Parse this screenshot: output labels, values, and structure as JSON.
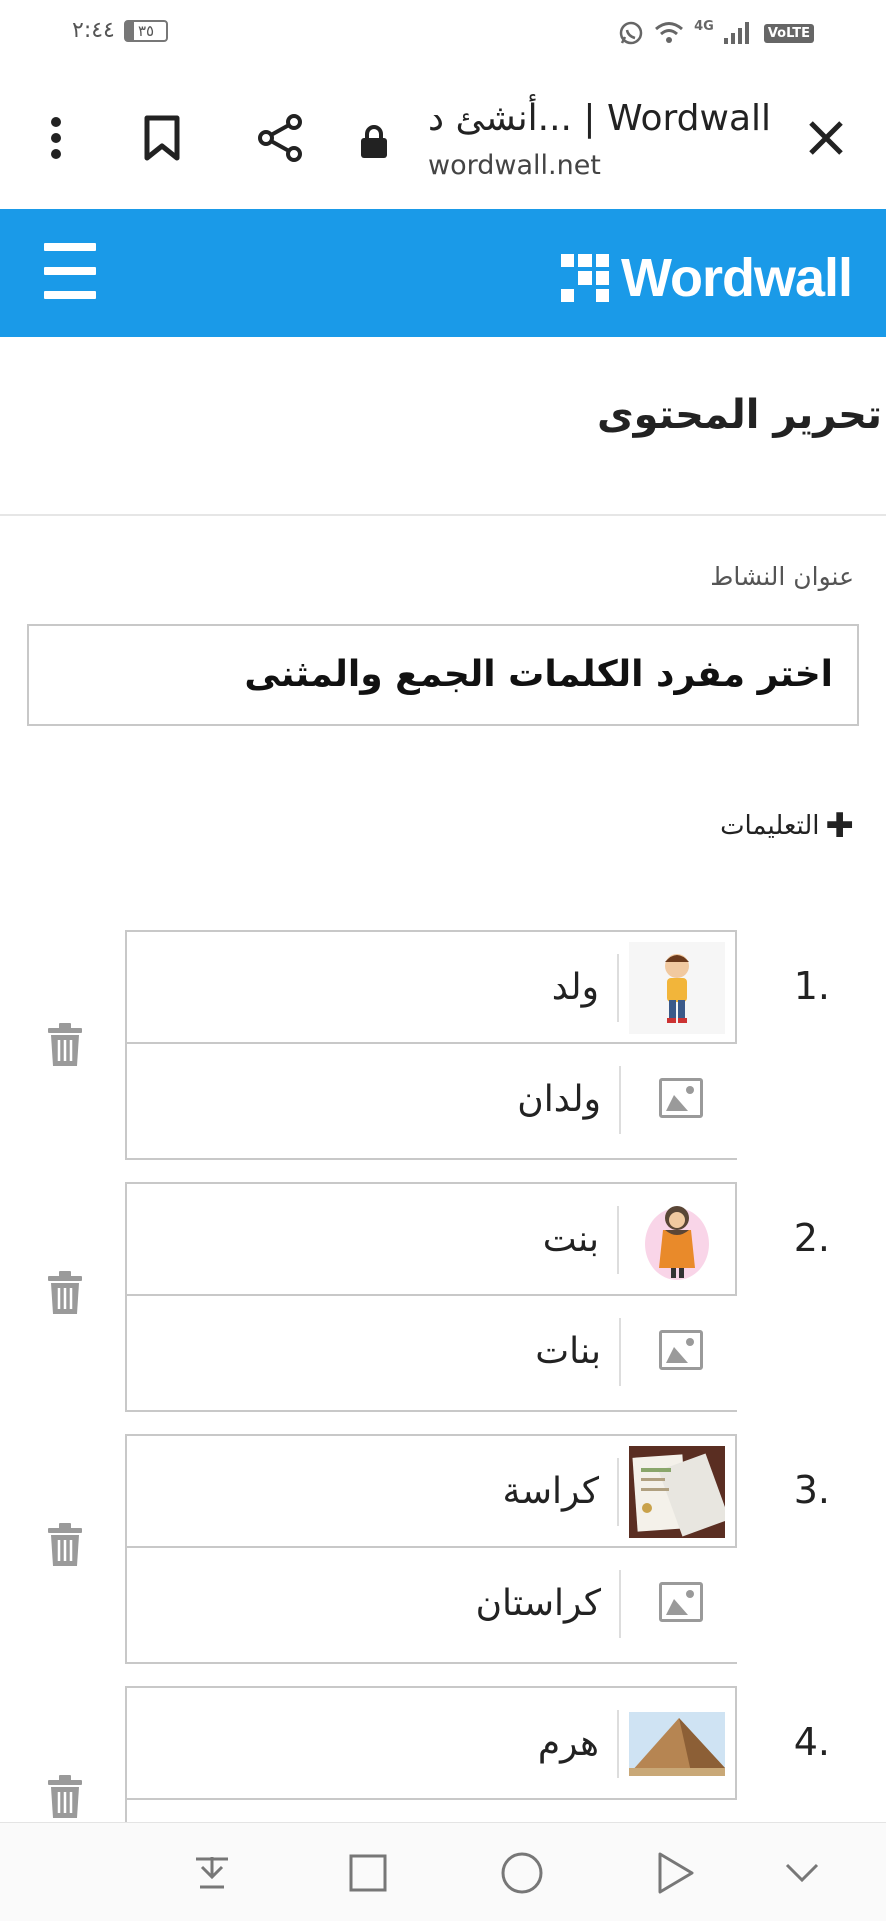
{
  "status_bar": {
    "time": "٢:٤٤",
    "battery": "٣٥",
    "network": "4G",
    "volte": "VoLTE"
  },
  "browser": {
    "title": "أنشئ د... | Wordwall",
    "url": "wordwall.net"
  },
  "header": {
    "logo_text": "Wordwall",
    "brand_color": "#1a9ae8"
  },
  "page_title": "تحرير المحتوى",
  "activity": {
    "label": "عنوان النشاط",
    "title_value": "اختر مفرد الكلمات الجمع والمثنى"
  },
  "instructions_label": "التعليمات",
  "items": [
    {
      "num": "1.",
      "word1": "ولد",
      "word2": "ولدان",
      "image_icon": "boy-image-icon"
    },
    {
      "num": "2.",
      "word1": "بنت",
      "word2": "بنات",
      "image_icon": "girl-image-icon"
    },
    {
      "num": "3.",
      "word1": "كراسة",
      "word2": "كراستان",
      "image_icon": "notebook-image-icon"
    },
    {
      "num": "4.",
      "word1": "هرم",
      "word2": "",
      "image_icon": "pyramid-image-icon"
    }
  ]
}
